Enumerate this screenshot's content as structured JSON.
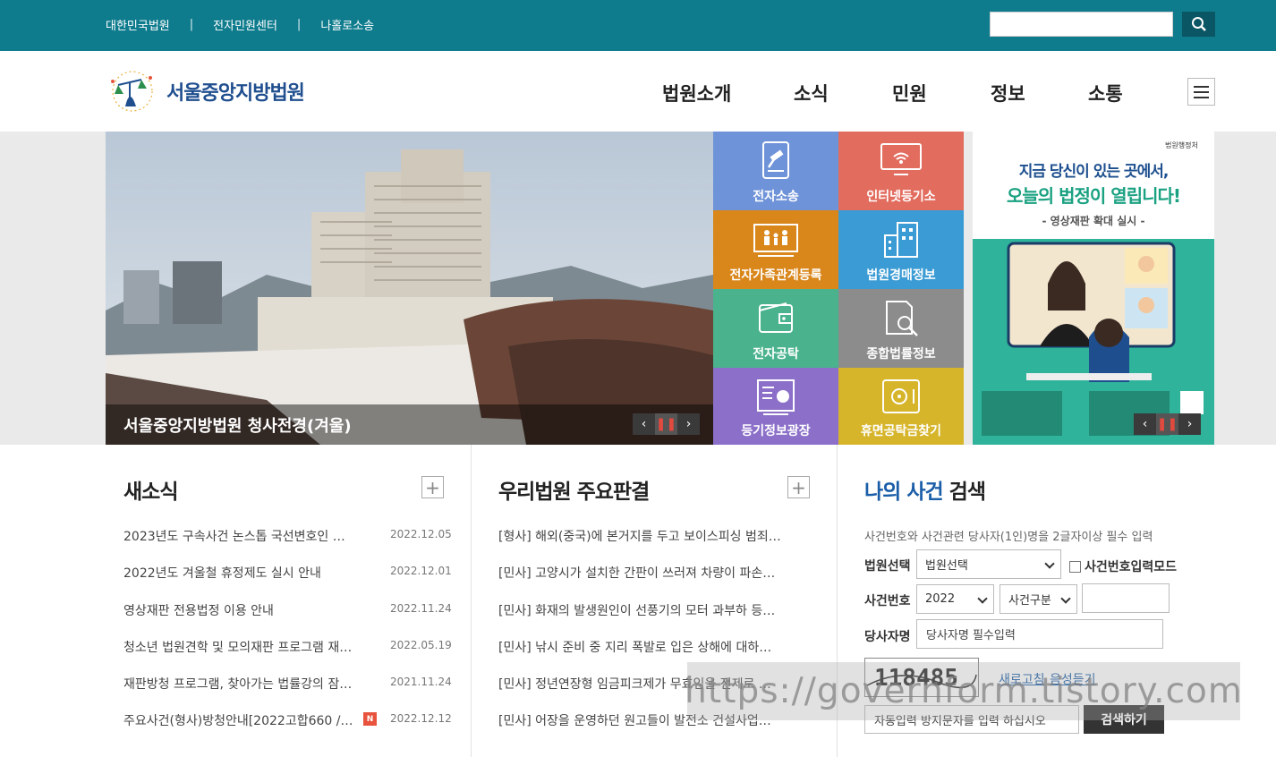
{
  "top": {
    "links": [
      "대한민국법원",
      "전자민원센터",
      "나홀로소송"
    ],
    "separator": "|"
  },
  "header": {
    "logo_text": "서울중앙지방법원",
    "nav": [
      "법원소개",
      "소식",
      "민원",
      "정보",
      "소통"
    ]
  },
  "hero": {
    "caption": "서울중앙지방법원 청사전경(겨울)"
  },
  "tiles": [
    {
      "label": "전자소송",
      "color": "#6f93d8",
      "icon": "gavel-tablet-icon"
    },
    {
      "label": "인터넷등기소",
      "color": "#e26c5e",
      "icon": "monitor-wifi-icon"
    },
    {
      "label": "전자가족관계등록",
      "color": "#d9861b",
      "icon": "family-icon"
    },
    {
      "label": "법원경매정보",
      "color": "#3b9bd4",
      "icon": "buildings-icon"
    },
    {
      "label": "전자공탁",
      "color": "#4ab38d",
      "icon": "wallet-icon"
    },
    {
      "label": "종합법률정보",
      "color": "#8c8c8c",
      "icon": "document-search-icon"
    },
    {
      "label": "등기정보광장",
      "color": "#8b6fc9",
      "icon": "chart-doc-icon"
    },
    {
      "label": "휴면공탁금찾기",
      "color": "#d6b52a",
      "icon": "safe-icon"
    }
  ],
  "banner": {
    "badge": "법원행정처",
    "line1": "지금 당신이 있는 곳에서,",
    "line2": "오늘의 법정이 열립니다!",
    "subtitle": "- 영상재판 확대 실시 -"
  },
  "news": {
    "title": "새소식",
    "plus": "+",
    "items": [
      {
        "title": "2023년도 구속사건 논스톱 국선변호인 모…",
        "date": "2022.12.05",
        "new": false
      },
      {
        "title": "2022년도 겨울철 휴정제도 실시 안내",
        "date": "2022.12.01",
        "new": false
      },
      {
        "title": "영상재판 전용법정 이용 안내",
        "date": "2022.11.24",
        "new": false
      },
      {
        "title": "청소년 법원견학 및 모의재판 프로그램 재…",
        "date": "2022.05.19",
        "new": false
      },
      {
        "title": "재판방청 프로그램, 찾아가는 법률강의 잠…",
        "date": "2021.11.24",
        "new": false
      },
      {
        "title": "주요사건(형사)방청안내[2022고합660 / …",
        "date": "2022.12.12",
        "new": true,
        "badge": "N"
      }
    ]
  },
  "rulings": {
    "title": "우리법원 주요판결",
    "plus": "+",
    "items": [
      "[형사] 해외(중국)에 본거지를 두고 보이스피싱 범죄…",
      "[민사] 고양시가 설치한 간판이 쓰러져 차량이 파손…",
      "[민사] 화재의 발생원인이 선풍기의 모터 과부하 등…",
      "[민사] 낚시 준비 중 지리 폭발로 입은 상해에 대하여…",
      "[민사] 정년연장형 임금피크제가 무효임을 전제로 …",
      "[민사] 어장을 운영하던 원고들이 발전소 건설사업…"
    ]
  },
  "case_search": {
    "title_blue": "나의 사건",
    "title_rest": "검색",
    "desc": "사건번호와 사건관련 당사자(1인)명을 2글자이상 필수 입력",
    "court_label": "법원선택",
    "court_value": "법원선택",
    "mode_label": "사건번호입력모드",
    "case_label": "사건번호",
    "year_value": "2022",
    "type_value": "사건구분",
    "party_label": "당사자명",
    "party_placeholder": "당사자명 필수입력",
    "captcha_text": "118485",
    "refresh": "새로고침",
    "audio": "음성듣기",
    "captcha_placeholder": "자동입력 방지문자를 입력 하십시오",
    "submit": "검색하기"
  },
  "watermark": "https://governform.tistory.com"
}
